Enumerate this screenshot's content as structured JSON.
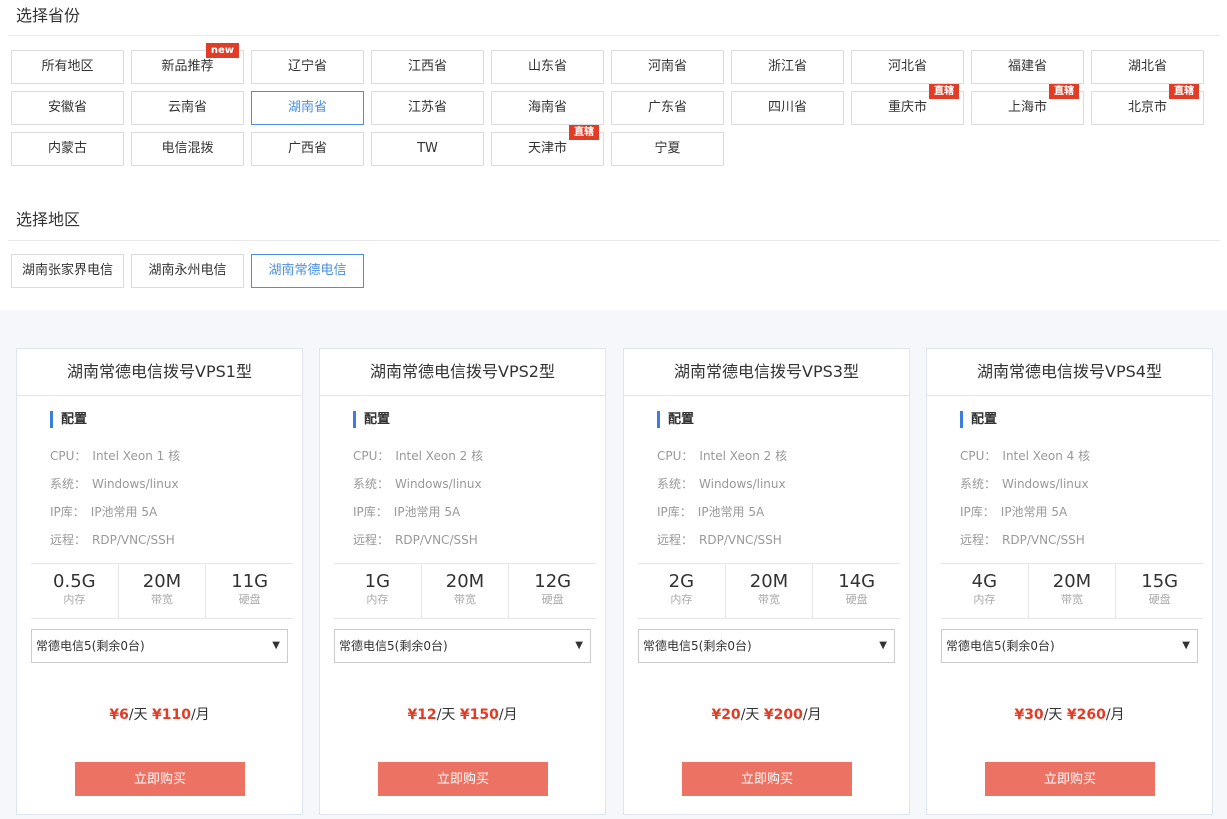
{
  "province_section": {
    "title": "选择省份",
    "items": [
      {
        "label": "所有地区",
        "selected": false,
        "badge": ""
      },
      {
        "label": "新品推荐",
        "selected": false,
        "badge": "new"
      },
      {
        "label": "辽宁省",
        "selected": false,
        "badge": ""
      },
      {
        "label": "江西省",
        "selected": false,
        "badge": ""
      },
      {
        "label": "山东省",
        "selected": false,
        "badge": ""
      },
      {
        "label": "河南省",
        "selected": false,
        "badge": ""
      },
      {
        "label": "浙江省",
        "selected": false,
        "badge": ""
      },
      {
        "label": "河北省",
        "selected": false,
        "badge": ""
      },
      {
        "label": "福建省",
        "selected": false,
        "badge": ""
      },
      {
        "label": "湖北省",
        "selected": false,
        "badge": ""
      },
      {
        "label": "安徽省",
        "selected": false,
        "badge": ""
      },
      {
        "label": "云南省",
        "selected": false,
        "badge": ""
      },
      {
        "label": "湖南省",
        "selected": true,
        "badge": ""
      },
      {
        "label": "江苏省",
        "selected": false,
        "badge": ""
      },
      {
        "label": "海南省",
        "selected": false,
        "badge": ""
      },
      {
        "label": "广东省",
        "selected": false,
        "badge": ""
      },
      {
        "label": "四川省",
        "selected": false,
        "badge": ""
      },
      {
        "label": "重庆市",
        "selected": false,
        "badge": "直辖"
      },
      {
        "label": "上海市",
        "selected": false,
        "badge": "直辖"
      },
      {
        "label": "北京市",
        "selected": false,
        "badge": "直辖"
      },
      {
        "label": "内蒙古",
        "selected": false,
        "badge": ""
      },
      {
        "label": "电信混拨",
        "selected": false,
        "badge": ""
      },
      {
        "label": "广西省",
        "selected": false,
        "badge": ""
      },
      {
        "label": "TW",
        "selected": false,
        "badge": ""
      },
      {
        "label": "天津市",
        "selected": false,
        "badge": "直辖"
      },
      {
        "label": "宁夏",
        "selected": false,
        "badge": ""
      }
    ]
  },
  "region_section": {
    "title": "选择地区",
    "items": [
      {
        "label": "湖南张家界电信",
        "selected": false
      },
      {
        "label": "湖南永州电信",
        "selected": false
      },
      {
        "label": "湖南常德电信",
        "selected": true
      }
    ]
  },
  "colors": {
    "accent_blue": "#4a8fe0",
    "price_red": "#e23b26",
    "buy_button": "#ec7263"
  },
  "products": [
    {
      "title": "湖南常德电信拨号VPS1型",
      "config_heading": "配置",
      "specs": [
        {
          "key": "CPU：",
          "value": "Intel Xeon 1 核"
        },
        {
          "key": "系统：",
          "value": "Windows/linux"
        },
        {
          "key": "IP库：",
          "value": "IP池常用 5A"
        },
        {
          "key": "远程：",
          "value": "RDP/VNC/SSH"
        }
      ],
      "stats": [
        {
          "value": "0.5G",
          "unit": "内存"
        },
        {
          "value": "20M",
          "unit": "带宽"
        },
        {
          "value": "11G",
          "unit": "硬盘"
        }
      ],
      "select_value": "常德电信5(剩余0台)",
      "price_day": "¥6",
      "day_unit": "/天",
      "price_month": "¥110",
      "month_unit": "/月",
      "buy_label": "立即购买"
    },
    {
      "title": "湖南常德电信拨号VPS2型",
      "config_heading": "配置",
      "specs": [
        {
          "key": "CPU：",
          "value": "Intel Xeon 2 核"
        },
        {
          "key": "系统：",
          "value": "Windows/linux"
        },
        {
          "key": "IP库：",
          "value": "IP池常用 5A"
        },
        {
          "key": "远程：",
          "value": "RDP/VNC/SSH"
        }
      ],
      "stats": [
        {
          "value": "1G",
          "unit": "内存"
        },
        {
          "value": "20M",
          "unit": "带宽"
        },
        {
          "value": "12G",
          "unit": "硬盘"
        }
      ],
      "select_value": "常德电信5(剩余0台)",
      "price_day": "¥12",
      "day_unit": "/天",
      "price_month": "¥150",
      "month_unit": "/月",
      "buy_label": "立即购买"
    },
    {
      "title": "湖南常德电信拨号VPS3型",
      "config_heading": "配置",
      "specs": [
        {
          "key": "CPU：",
          "value": "Intel Xeon 2 核"
        },
        {
          "key": "系统：",
          "value": "Windows/linux"
        },
        {
          "key": "IP库：",
          "value": "IP池常用 5A"
        },
        {
          "key": "远程：",
          "value": "RDP/VNC/SSH"
        }
      ],
      "stats": [
        {
          "value": "2G",
          "unit": "内存"
        },
        {
          "value": "20M",
          "unit": "带宽"
        },
        {
          "value": "14G",
          "unit": "硬盘"
        }
      ],
      "select_value": "常德电信5(剩余0台)",
      "price_day": "¥20",
      "day_unit": "/天",
      "price_month": "¥200",
      "month_unit": "/月",
      "buy_label": "立即购买"
    },
    {
      "title": "湖南常德电信拨号VPS4型",
      "config_heading": "配置",
      "specs": [
        {
          "key": "CPU：",
          "value": "Intel Xeon 4 核"
        },
        {
          "key": "系统：",
          "value": "Windows/linux"
        },
        {
          "key": "IP库：",
          "value": "IP池常用 5A"
        },
        {
          "key": "远程：",
          "value": "RDP/VNC/SSH"
        }
      ],
      "stats": [
        {
          "value": "4G",
          "unit": "内存"
        },
        {
          "value": "20M",
          "unit": "带宽"
        },
        {
          "value": "15G",
          "unit": "硬盘"
        }
      ],
      "select_value": "常德电信5(剩余0台)",
      "price_day": "¥30",
      "day_unit": "/天",
      "price_month": "¥260",
      "month_unit": "/月",
      "buy_label": "立即购买"
    }
  ]
}
